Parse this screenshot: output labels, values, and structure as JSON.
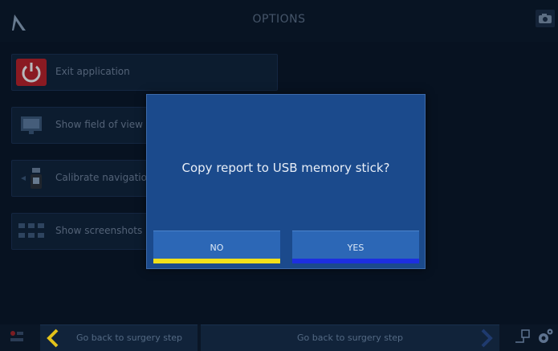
{
  "header": {
    "title": "OPTIONS",
    "logo_icon": "caret-logo-icon",
    "camera_icon": "camera-icon"
  },
  "options": [
    {
      "label": "Exit application",
      "icon": "power-icon",
      "icon_color": "#c8252a"
    },
    {
      "label": "Show field of view",
      "icon": "monitor-icon"
    },
    {
      "label": "Calibrate navigation",
      "icon": "camera-device-icon"
    },
    {
      "label": "Show screenshots",
      "icon": "thumbnails-icon"
    }
  ],
  "dialog": {
    "message": "Copy report to USB memory stick?",
    "no_label": "NO",
    "yes_label": "YES",
    "no_bar_color": "#f2e01a",
    "yes_bar_color": "#1d2fe0"
  },
  "footer": {
    "back_left_label": "Go back to surgery step",
    "back_right_label": "Go back to surgery step",
    "left_arrow_color": "#e3c21a",
    "right_arrow_color": "#1f3a6e"
  }
}
